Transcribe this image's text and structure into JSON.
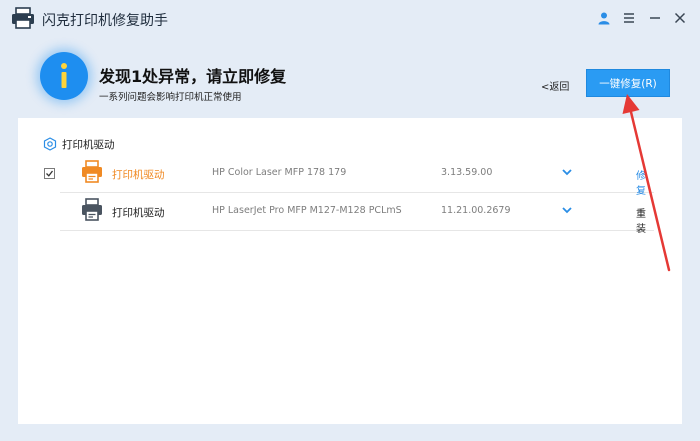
{
  "window": {
    "title": "闪克打印机修复助手",
    "icons": [
      "printer-logo-icon",
      "user-icon",
      "menu-icon",
      "minimize-icon",
      "close-icon"
    ]
  },
  "header": {
    "status_icon": "info-icon",
    "title": "发现1处异常，请立即修复",
    "subtitle": "一系列问题会影响打印机正常使用",
    "back_label": "<返回",
    "fix_all_label": "一键修复(R)"
  },
  "section": {
    "title": "打印机驱动",
    "icon": "hexagon-icon"
  },
  "drivers": [
    {
      "name": "打印机驱动",
      "model": "HP Color Laser MFP 178 179",
      "version": "3.13.59.00",
      "action": "修复",
      "status": "abnormal",
      "checked": true
    },
    {
      "name": "打印机驱动",
      "model": "HP LaserJet Pro MFP M127-M128 PCLmS",
      "version": "11.21.00.2679",
      "action": "重装",
      "status": "normal",
      "checked": false
    }
  ],
  "colors": {
    "accent": "#2a9bf3",
    "warning": "#f08a24",
    "annotation_arrow": "#e53935",
    "background": "#e4ecf6"
  }
}
